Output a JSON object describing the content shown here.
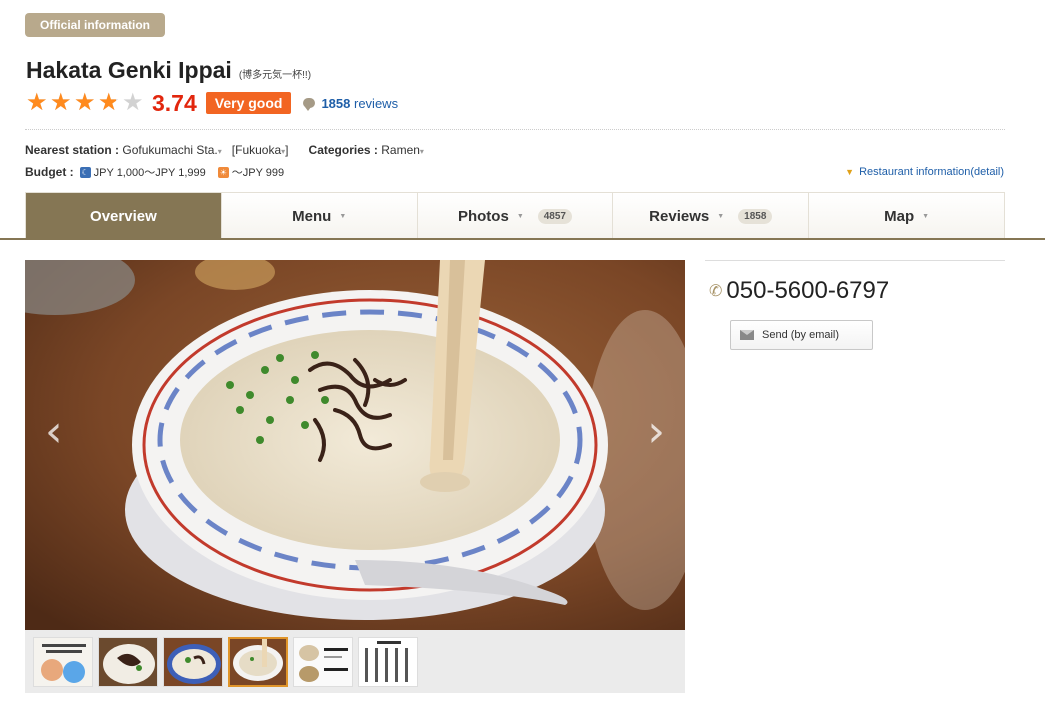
{
  "badge": "Official information",
  "restaurant": {
    "name": "Hakata Genki Ippai",
    "name_jp": "(博多元気一杯!!)"
  },
  "rating": {
    "stars": 3.74,
    "score": "3.74",
    "grade": "Very good",
    "review_count": "1858",
    "review_suffix": "reviews"
  },
  "info": {
    "station_label": "Nearest station :",
    "station": "Gofukumachi Sta.",
    "area": "[Fukuoka",
    "area_close": "]",
    "categories_label": "Categories :",
    "category": "Ramen",
    "budget_label": "Budget :",
    "budget_dinner": "JPY 1,000～JPY 1,999",
    "budget_lunch": "～JPY 999",
    "detail_link": "Restaurant information(detail)"
  },
  "tabs": [
    {
      "label": "Overview",
      "count": ""
    },
    {
      "label": "Menu",
      "count": ""
    },
    {
      "label": "Photos",
      "count": "4857"
    },
    {
      "label": "Reviews",
      "count": "1858"
    },
    {
      "label": "Map",
      "count": ""
    }
  ],
  "contact": {
    "phone": "050-5600-6797",
    "email_button": "Send (by email)"
  },
  "thumbnails": {
    "count": 6,
    "active_index": 3
  },
  "colors": {
    "accent": "#857654",
    "score": "#e2260d",
    "grade_badge": "#f26522",
    "star": "#ff8a1d",
    "link": "#1e5ea8"
  }
}
